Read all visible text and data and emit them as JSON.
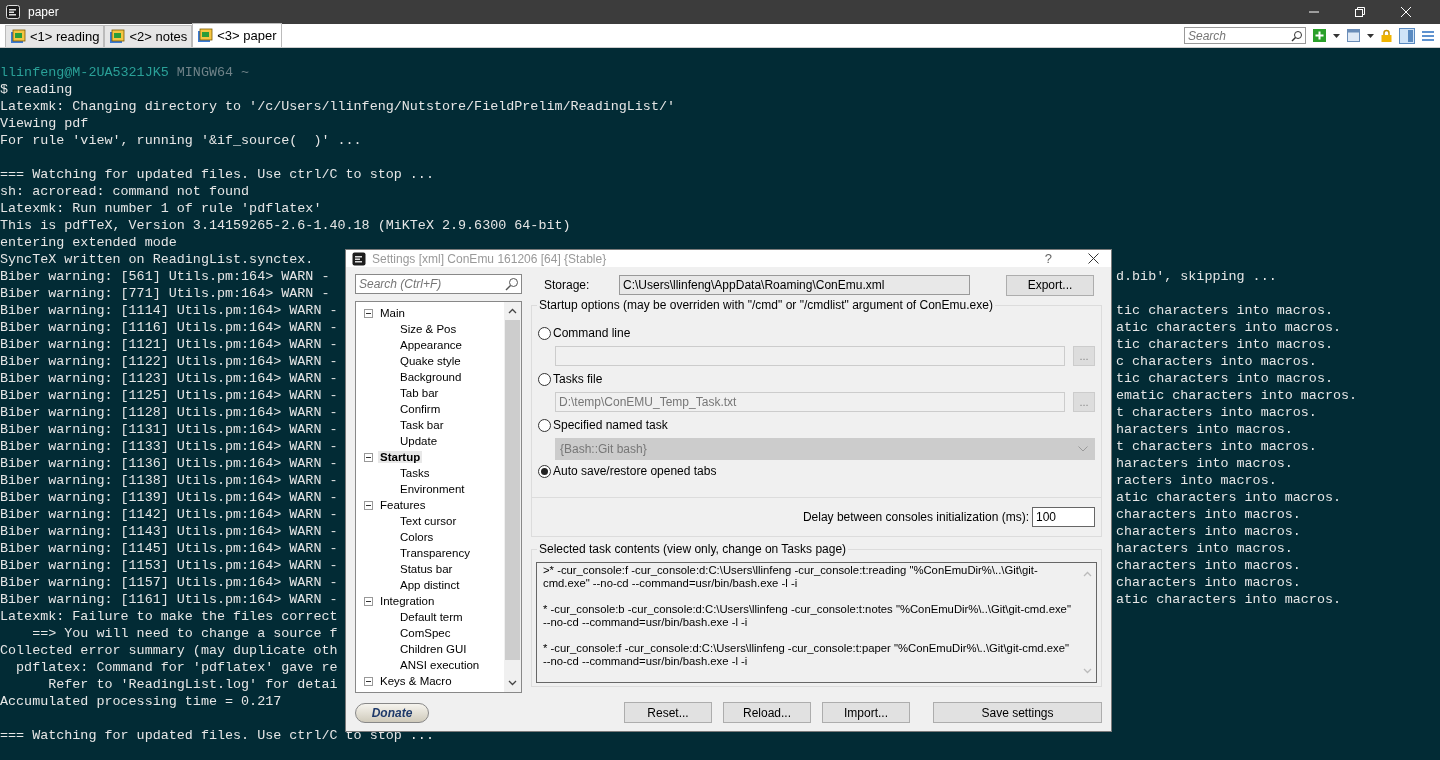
{
  "window": {
    "title": "paper"
  },
  "tabs": [
    {
      "label": "<1> reading",
      "selected": false
    },
    {
      "label": "<2> notes",
      "selected": false
    },
    {
      "label": "<3> paper",
      "selected": true
    }
  ],
  "toolbar": {
    "search": {
      "placeholder": "Search"
    }
  },
  "terminal": {
    "lines": [
      {
        "kind": "prompt",
        "user": "llinfeng@M-2UA5321JK5",
        "host": "MINGW64 ~"
      },
      {
        "kind": "full",
        "text": "$ reading"
      },
      {
        "kind": "full",
        "text": "Latexmk: Changing directory to '/c/Users/llinfeng/Nutstore/FieldPrelim/ReadingList/'"
      },
      {
        "kind": "full",
        "text": "Viewing pdf"
      },
      {
        "kind": "full",
        "text": "For rule 'view', running '&if_source(  )' ..."
      },
      {
        "kind": "blank"
      },
      {
        "kind": "full",
        "text": "=== Watching for updated files. Use ctrl/C to stop ..."
      },
      {
        "kind": "full",
        "text": "sh: acroread: command not found"
      },
      {
        "kind": "full",
        "text": "Latexmk: Run number 1 of rule 'pdflatex'"
      },
      {
        "kind": "full",
        "text": "This is pdfTeX, Version 3.14159265-2.6-1.40.18 (MiKTeX 2.9.6300 64-bit)"
      },
      {
        "kind": "full",
        "text": "entering extended mode"
      },
      {
        "kind": "full",
        "text": "SyncTeX written on ReadingList.synctex."
      },
      {
        "kind": "split",
        "left": "Biber warning: [561] Utils.pm:164> WARN -",
        "right": "d.bib', skipping ..."
      },
      {
        "kind": "split",
        "left": "Biber warning: [771] Utils.pm:164> WARN -"
      },
      {
        "kind": "split",
        "left": "Biber warning: [1114] Utils.pm:164> WARN -",
        "right": "tic characters into macros."
      },
      {
        "kind": "split",
        "left": "Biber warning: [1116] Utils.pm:164> WARN -",
        "right": "atic characters into macros."
      },
      {
        "kind": "split",
        "left": "Biber warning: [1121] Utils.pm:164> WARN -",
        "right": "tic characters into macros."
      },
      {
        "kind": "split",
        "left": "Biber warning: [1122] Utils.pm:164> WARN -",
        "right": "c characters into macros."
      },
      {
        "kind": "split",
        "left": "Biber warning: [1123] Utils.pm:164> WARN -",
        "right": "tic characters into macros."
      },
      {
        "kind": "split",
        "left": "Biber warning: [1125] Utils.pm:164> WARN -",
        "right": "ematic characters into macros."
      },
      {
        "kind": "split",
        "left": "Biber warning: [1128] Utils.pm:164> WARN -",
        "right": "t characters into macros."
      },
      {
        "kind": "split",
        "left": "Biber warning: [1131] Utils.pm:164> WARN -",
        "right": "haracters into macros."
      },
      {
        "kind": "split",
        "left": "Biber warning: [1133] Utils.pm:164> WARN -",
        "right": "t characters into macros."
      },
      {
        "kind": "split",
        "left": "Biber warning: [1136] Utils.pm:164> WARN -",
        "right": "haracters into macros."
      },
      {
        "kind": "split",
        "left": "Biber warning: [1138] Utils.pm:164> WARN -",
        "right": "racters into macros."
      },
      {
        "kind": "split",
        "left": "Biber warning: [1139] Utils.pm:164> WARN -",
        "right": "atic characters into macros."
      },
      {
        "kind": "split",
        "left": "Biber warning: [1142] Utils.pm:164> WARN -",
        "right": "characters into macros."
      },
      {
        "kind": "split",
        "left": "Biber warning: [1143] Utils.pm:164> WARN -",
        "right": "characters into macros."
      },
      {
        "kind": "split",
        "left": "Biber warning: [1145] Utils.pm:164> WARN -",
        "right": "haracters into macros."
      },
      {
        "kind": "split",
        "left": "Biber warning: [1153] Utils.pm:164> WARN -",
        "right": "characters into macros."
      },
      {
        "kind": "split",
        "left": "Biber warning: [1157] Utils.pm:164> WARN -",
        "right": "characters into macros."
      },
      {
        "kind": "split",
        "left": "Biber warning: [1161] Utils.pm:164> WARN -",
        "right": "atic characters into macros."
      },
      {
        "kind": "split",
        "left": "Latexmk: Failure to make the files correct"
      },
      {
        "kind": "split",
        "left": "    ==> You will need to change a source f"
      },
      {
        "kind": "split",
        "left": "Collected error summary (may duplicate oth"
      },
      {
        "kind": "split",
        "left": "  pdflatex: Command for 'pdflatex' gave re"
      },
      {
        "kind": "split",
        "left": "      Refer to 'ReadingList.log' for detai"
      },
      {
        "kind": "full",
        "text": "Accumulated processing time = 0.217"
      },
      {
        "kind": "blank"
      },
      {
        "kind": "full",
        "text": "=== Watching for updated files. Use ctrl/C to stop ..."
      }
    ]
  },
  "dialog": {
    "title": "Settings [xml] ConEmu 161206 [64] {Stable}",
    "help": "?",
    "search": {
      "placeholder": "Search (Ctrl+F)"
    },
    "tree": [
      {
        "label": "Main",
        "selected": false,
        "expanded": true,
        "children": [
          {
            "label": "Size & Pos",
            "selected": false
          },
          {
            "label": "Appearance",
            "selected": false
          },
          {
            "label": "Quake style",
            "selected": false
          },
          {
            "label": "Background",
            "selected": false
          },
          {
            "label": "Tab bar",
            "selected": false
          },
          {
            "label": "Confirm",
            "selected": false
          },
          {
            "label": "Task bar",
            "selected": false
          },
          {
            "label": "Update",
            "selected": false
          }
        ]
      },
      {
        "label": "Startup",
        "selected": true,
        "expanded": true,
        "children": [
          {
            "label": "Tasks",
            "selected": false
          },
          {
            "label": "Environment",
            "selected": false
          }
        ]
      },
      {
        "label": "Features",
        "selected": false,
        "expanded": true,
        "children": [
          {
            "label": "Text cursor",
            "selected": false
          },
          {
            "label": "Colors",
            "selected": false
          },
          {
            "label": "Transparency",
            "selected": false
          },
          {
            "label": "Status bar",
            "selected": false
          },
          {
            "label": "App distinct",
            "selected": false
          }
        ]
      },
      {
        "label": "Integration",
        "selected": false,
        "expanded": true,
        "children": [
          {
            "label": "Default term",
            "selected": false
          },
          {
            "label": "ComSpec",
            "selected": false
          },
          {
            "label": "Children GUI",
            "selected": false
          },
          {
            "label": "ANSI execution",
            "selected": false
          }
        ]
      },
      {
        "label": "Keys & Macro",
        "selected": false,
        "expanded": true
      }
    ],
    "donate": "Donate",
    "storage": {
      "label": "Storage:",
      "value": "C:\\Users\\llinfeng\\AppData\\Roaming\\ConEmu.xml",
      "button": "Export..."
    },
    "startup_group": {
      "title": "Startup options (may be overriden with \"/cmd\" or \"/cmdlist\" argument of ConEmu.exe)",
      "options": [
        {
          "label": "Command line",
          "selected": false,
          "kind": "field",
          "field": {
            "disabled": true
          },
          "browse": "..."
        },
        {
          "label": "Tasks file",
          "selected": false,
          "kind": "field",
          "field": {
            "value": "D:\\temp\\ConEMU_Temp_Task.txt",
            "disabled": true
          },
          "browse": "..."
        },
        {
          "label": "Specified named task",
          "selected": false,
          "kind": "dropdown",
          "field": {
            "value": "{Bash::Git bash}",
            "disabled": true
          }
        },
        {
          "label": "Auto save/restore opened tabs",
          "selected": true,
          "kind": "plain"
        }
      ],
      "delay": {
        "label": "Delay between consoles initialization (ms):",
        "value": "100"
      }
    },
    "task_group": {
      "title": "Selected task contents (view only, change on Tasks page)",
      "paragraphs": [
        ">* -cur_console:f -cur_console:d:C:\\Users\\llinfeng -cur_console:t:reading \"%ConEmuDir%\\..\\Git\\git-cmd.exe\" --no-cd --command=usr/bin/bash.exe -l -i",
        "* -cur_console:b -cur_console:d:C:\\Users\\llinfeng -cur_console:t:notes \"%ConEmuDir%\\..\\Git\\git-cmd.exe\" --no-cd --command=usr/bin/bash.exe -l -i",
        "* -cur_console:f -cur_console:d:C:\\Users\\llinfeng -cur_console:t:paper \"%ConEmuDir%\\..\\Git\\git-cmd.exe\" --no-cd --command=usr/bin/bash.exe -l -i"
      ]
    },
    "buttons": [
      "Reset...",
      "Reload...",
      "Import...",
      "Save settings"
    ]
  }
}
